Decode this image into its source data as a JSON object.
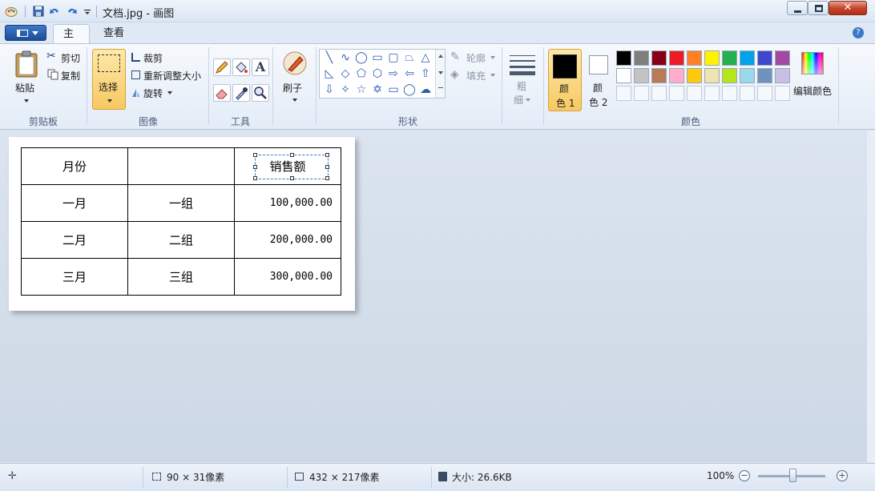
{
  "window": {
    "title": "文档.jpg - 画图"
  },
  "tabs": [
    {
      "label": "主页"
    },
    {
      "label": "查看"
    }
  ],
  "ribbon": {
    "clipboard": {
      "paste": "粘贴",
      "cut": "剪切",
      "copy": "复制",
      "label": "剪贴板"
    },
    "image": {
      "select": "选择",
      "crop": "裁剪",
      "resize": "重新调整大小",
      "rotate": "旋转",
      "label": "图像"
    },
    "tools": {
      "label": "工具"
    },
    "brushes": {
      "label": "刷子"
    },
    "shapes": {
      "outline": "轮廓",
      "fill": "填充",
      "label": "形状"
    },
    "size": {
      "line1": "粗",
      "line2": "细"
    },
    "colors": {
      "color1_line1": "颜",
      "color1_line2": "色 1",
      "color2_line1": "颜",
      "color2_line2": "色 2",
      "edit": "编辑颜色",
      "label": "颜色",
      "color1": "#000000",
      "color2": "#ffffff",
      "palette_row1": [
        "#000000",
        "#7f7f7f",
        "#880015",
        "#ed1c24",
        "#ff7f27",
        "#fff200",
        "#22b14c",
        "#00a2e8",
        "#3f48cc",
        "#a349a4"
      ],
      "palette_row2": [
        "#ffffff",
        "#c3c3c3",
        "#b97a57",
        "#ffaec9",
        "#ffc90e",
        "#efe4b0",
        "#b5e61d",
        "#99d9ea",
        "#7092be",
        "#c8bfe7"
      ]
    }
  },
  "canvas": {
    "table": [
      [
        "月份",
        "",
        "销售额"
      ],
      [
        "一月",
        "一组",
        "100,000.00"
      ],
      [
        "二月",
        "二组",
        "200,000.00"
      ],
      [
        "三月",
        "三组",
        "300,000.00"
      ]
    ]
  },
  "status": {
    "selection_size": "90 × 31像素",
    "image_size": "432 × 217像素",
    "file_size": "大小: 26.6KB",
    "zoom": "100%"
  }
}
